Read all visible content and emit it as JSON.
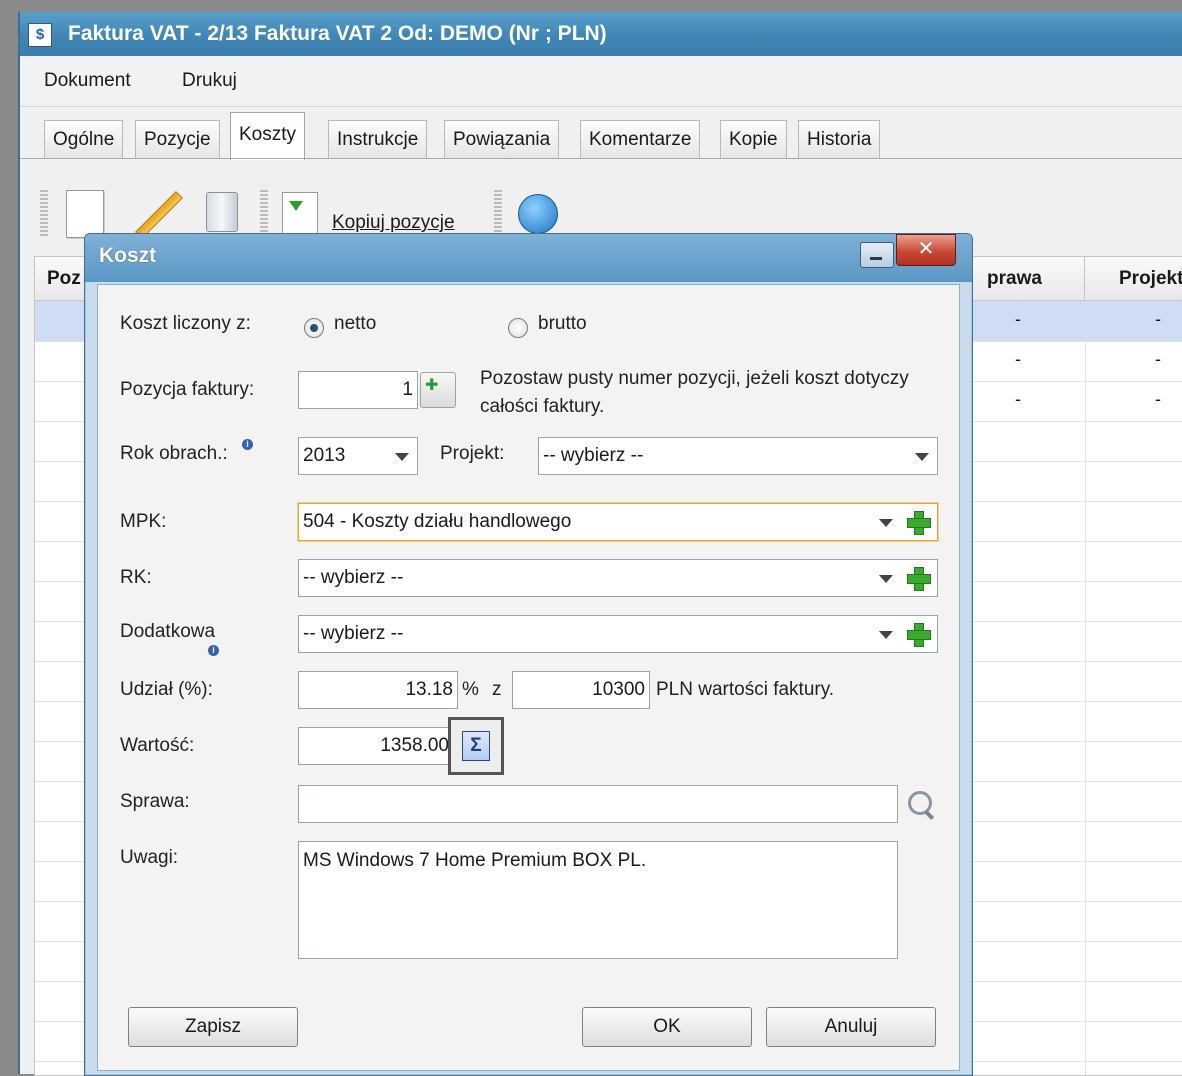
{
  "window": {
    "title": "Faktura VAT - 2/13 Faktura VAT 2 Od: DEMO (Nr ; PLN)",
    "icon": "dollar-doc-icon"
  },
  "menu": [
    "Dokument",
    "Drukuj"
  ],
  "tabs": [
    "Ogólne",
    "Pozycje",
    "Koszty",
    "Instrukcje",
    "Powiązania",
    "Komentarze",
    "Kopie",
    "Historia"
  ],
  "active_tab": "Koszty",
  "toolbar": {
    "copy_label": "Kopiuj pozycje"
  },
  "grid": {
    "headers": [
      "Poz",
      "prawa",
      "Projekt"
    ],
    "rows": [
      [
        "-",
        "-"
      ],
      [
        "-",
        "-"
      ],
      [
        "-",
        "-"
      ]
    ]
  },
  "dialog": {
    "title": "Koszt",
    "cost_from_label": "Koszt liczony z:",
    "netto_label": "netto",
    "brutto_label": "brutto",
    "position_label": "Pozycja faktury:",
    "position_value": "1",
    "position_hint": "Pozostaw pusty numer pozycji, jeżeli koszt dotyczy całości faktury.",
    "year_label": "Rok obrach.:",
    "year_value": "2013",
    "project_label": "Projekt:",
    "project_value": "-- wybierz --",
    "mpk_label": "MPK:",
    "mpk_value": "504 - Koszty działu handlowego",
    "rk_label": "RK:",
    "rk_value": "-- wybierz --",
    "extra_label": "Dodatkowa",
    "extra_value": "-- wybierz --",
    "share_label": "Udział (%):",
    "share_value": "13.18",
    "share_pct": "%",
    "share_z": "z",
    "invoice_value": "10300",
    "invoice_suffix": "PLN wartości faktury.",
    "value_label": "Wartość:",
    "value_value": "1358.00",
    "case_label": "Sprawa:",
    "case_value": "",
    "notes_label": "Uwagi:",
    "notes_value": "MS Windows 7 Home Premium BOX PL.",
    "save_button": "Zapisz",
    "ok_button": "OK",
    "cancel_button": "Anuluj"
  }
}
